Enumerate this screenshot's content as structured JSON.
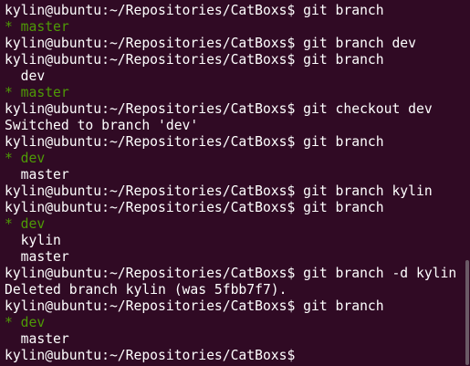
{
  "terminal": {
    "colors": {
      "background": "#300a24",
      "foreground": "#ffffff",
      "current_branch": "#4e9a06"
    },
    "lines": [
      {
        "text": "kylin@ubuntu:~/Repositories/CatBoxs$ git branch",
        "style": "prompt"
      },
      {
        "text": "* master",
        "style": "green"
      },
      {
        "text": "kylin@ubuntu:~/Repositories/CatBoxs$ git branch dev",
        "style": "prompt"
      },
      {
        "text": "kylin@ubuntu:~/Repositories/CatBoxs$ git branch",
        "style": "prompt"
      },
      {
        "text": "  dev",
        "style": "out"
      },
      {
        "text": "* master",
        "style": "green"
      },
      {
        "text": "kylin@ubuntu:~/Repositories/CatBoxs$ git checkout dev",
        "style": "prompt"
      },
      {
        "text": "Switched to branch 'dev'",
        "style": "out"
      },
      {
        "text": "kylin@ubuntu:~/Repositories/CatBoxs$ git branch",
        "style": "prompt"
      },
      {
        "text": "* dev",
        "style": "green"
      },
      {
        "text": "  master",
        "style": "out"
      },
      {
        "text": "kylin@ubuntu:~/Repositories/CatBoxs$ git branch kylin",
        "style": "prompt"
      },
      {
        "text": "kylin@ubuntu:~/Repositories/CatBoxs$ git branch",
        "style": "prompt"
      },
      {
        "text": "* dev",
        "style": "green"
      },
      {
        "text": "  kylin",
        "style": "out"
      },
      {
        "text": "  master",
        "style": "out"
      },
      {
        "text": "kylin@ubuntu:~/Repositories/CatBoxs$ git branch -d kylin",
        "style": "prompt"
      },
      {
        "text": "Deleted branch kylin (was 5fbb7f7).",
        "style": "out"
      },
      {
        "text": "kylin@ubuntu:~/Repositories/CatBoxs$ git branch",
        "style": "prompt"
      },
      {
        "text": "* dev",
        "style": "green"
      },
      {
        "text": "  master",
        "style": "out"
      },
      {
        "text": "kylin@ubuntu:~/Repositories/CatBoxs$ ",
        "style": "prompt"
      }
    ]
  }
}
